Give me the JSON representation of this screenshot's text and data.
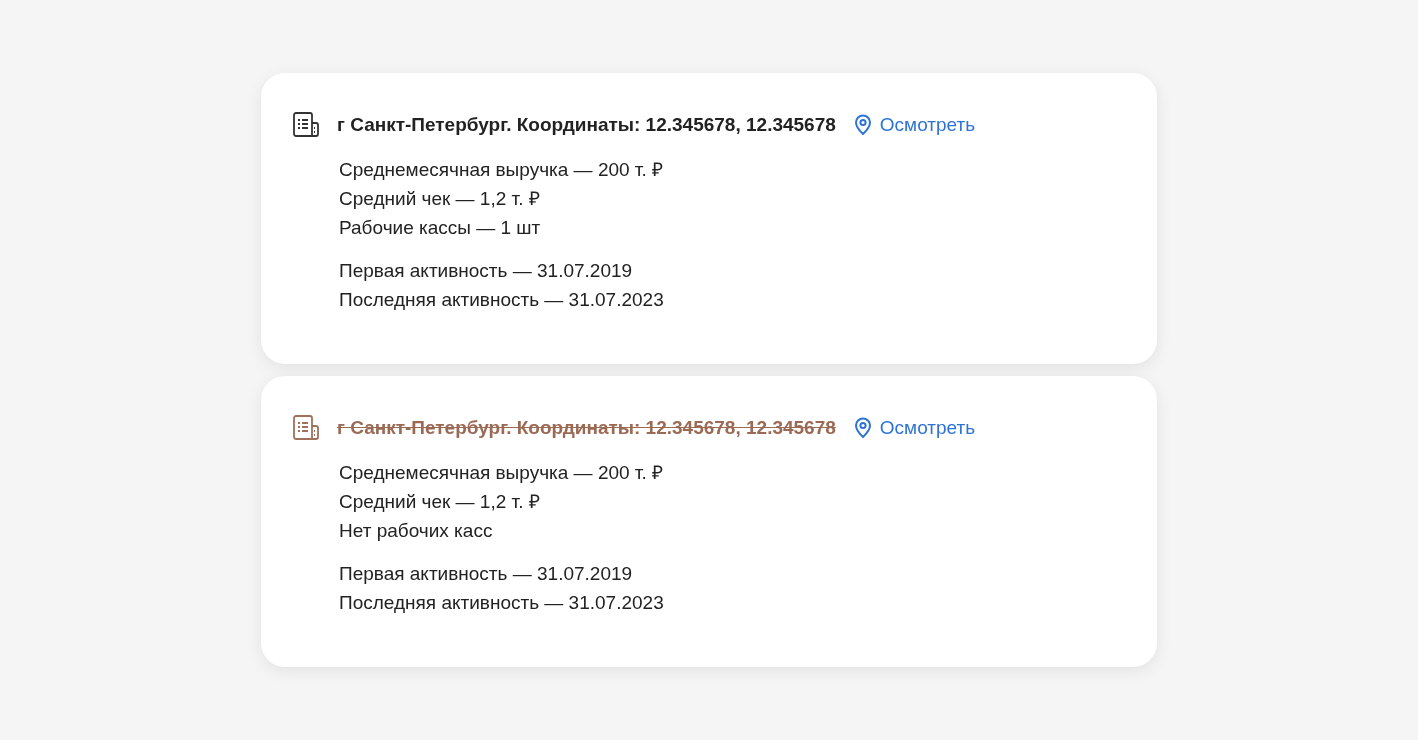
{
  "points": [
    {
      "address": "г Санкт-Петербург. Координаты: 12.345678, 12.345678",
      "closed": false,
      "link": "Осмотреть",
      "stats": [
        "Среднемесячная выручка — 200 т. ₽",
        "Средний чек — 1,2 т. ₽",
        "Рабочие кассы — 1 шт"
      ],
      "activity": [
        "Первая активность — 31.07.2019",
        "Последняя активность — 31.07.2023"
      ]
    },
    {
      "address": "г Санкт-Петербург. Координаты: 12.345678, 12.345678",
      "closed": true,
      "link": "Осмотреть",
      "stats": [
        "Среднемесячная выручка — 200 т. ₽",
        "Средний чек — 1,2 т. ₽",
        "Нет рабочих касс"
      ],
      "activity": [
        "Первая активность — 31.07.2019",
        "Последняя активность — 31.07.2023"
      ]
    }
  ]
}
